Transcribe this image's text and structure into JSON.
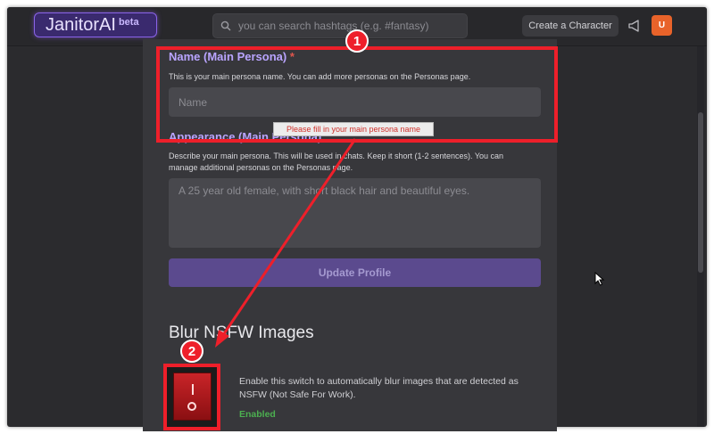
{
  "header": {
    "logo_text": "JanitorAI",
    "logo_beta": "beta",
    "search_placeholder": "you can search hashtags (e.g. #fantasy)",
    "create_character": "Create a Character",
    "avatar_letter": "U"
  },
  "form": {
    "name_label": "Name (Main Persona)",
    "name_required_mark": "*",
    "name_helper": "This is your main persona name. You can add more personas on the Personas page.",
    "name_placeholder": "Name",
    "validation_tooltip": "Please fill in your main persona name",
    "appearance_label": "Appearance (Main Persona)",
    "appearance_helper": "Describe your main persona. This will be used in chats. Keep it short (1-2 sentences). You can manage additional personas on the Personas page.",
    "appearance_placeholder": "A 25 year old female, with short black hair and beautiful eyes.",
    "update_button": "Update Profile"
  },
  "nsfw": {
    "title": "Blur NSFW Images",
    "description": "Enable this switch to automatically blur images that are detected as NSFW (Not Safe For Work).",
    "status": "Enabled"
  },
  "annotations": {
    "badge_1": "1",
    "badge_2": "2",
    "color": "#ee1f2a"
  }
}
